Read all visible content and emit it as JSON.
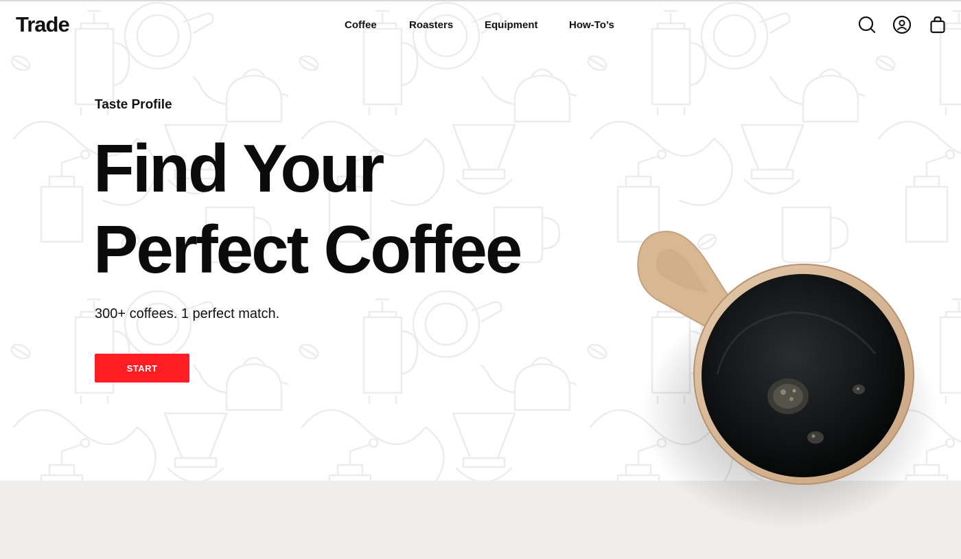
{
  "brand": {
    "logo_text": "Trade",
    "accent_color": "#ff1e24",
    "background_band_color": "#efeeec"
  },
  "nav": {
    "items": [
      {
        "label": "Coffee"
      },
      {
        "label": "Roasters"
      },
      {
        "label": "Equipment"
      },
      {
        "label": "How-To’s"
      }
    ]
  },
  "header_icons": {
    "search": "search-icon",
    "account": "account-icon",
    "cart": "shopping-bag-icon"
  },
  "hero": {
    "eyebrow": "Taste Profile",
    "headline_line1": "Find Your",
    "headline_line2": "Perfect Coffee",
    "subtext": "300+ coffees. 1 perfect match.",
    "cta_label": "START",
    "image": "coffee-mug-top-view",
    "background_pattern": "coffee-equipment-line-art"
  }
}
